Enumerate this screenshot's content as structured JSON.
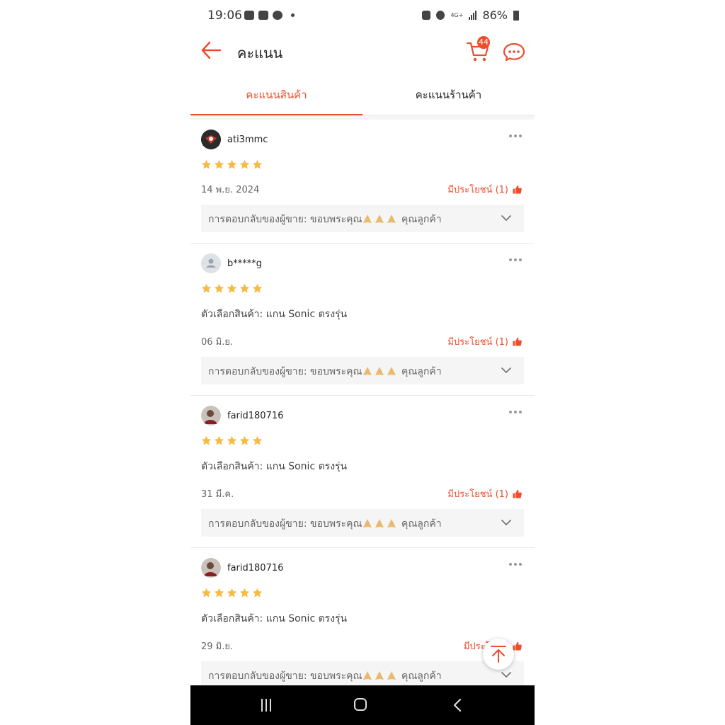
{
  "status_bar": {
    "time": "19:06",
    "network": "4G+",
    "battery": "86%"
  },
  "header": {
    "title": "คะแนน",
    "cart_count": "44",
    "icons": {
      "back": "arrow-left-icon",
      "cart": "cart-icon",
      "chat": "chat-icon"
    },
    "accent_color": "#ee4d2d"
  },
  "tabs": [
    {
      "label": "คะแนนสินค้า",
      "active": true
    },
    {
      "label": "คะแนนร้านค้า",
      "active": false
    }
  ],
  "reviews": [
    {
      "username": "ati3mmc",
      "rating": 5,
      "variation": "",
      "date": "14 พ.ย. 2024",
      "helpful": "มีประโยชน์ (1)",
      "reply_prefix": "การตอบกลับของผู้ขาย: ขอบพระคุณ",
      "reply_suffix": "คุณลูกค้า"
    },
    {
      "username": "b*****g",
      "rating": 5,
      "variation": "ตัวเลือกสินค้า: แกน Sonic ตรงรุ่น",
      "date": "06 มิ.ย.",
      "helpful": "มีประโยชน์ (1)",
      "reply_prefix": "การตอบกลับของผู้ขาย: ขอบพระคุณ",
      "reply_suffix": "คุณลูกค้า"
    },
    {
      "username": "farid180716",
      "rating": 5,
      "variation": "ตัวเลือกสินค้า: แกน Sonic ตรงรุ่น",
      "date": "31 มี.ค.",
      "helpful": "มีประโยชน์ (1)",
      "reply_prefix": "การตอบกลับของผู้ขาย: ขอบพระคุณ",
      "reply_suffix": "คุณลูกค้า"
    },
    {
      "username": "farid180716",
      "rating": 5,
      "variation": "ตัวเลือกสินค้า: แกน Sonic ตรงรุ่น",
      "date": "29 มิ.ย.",
      "helpful": "มีประโยชน์",
      "reply_prefix": "การตอบกลับของผู้ขาย: ขอบพระคุณ",
      "reply_suffix": "คุณลูกค้า"
    }
  ],
  "colors": {
    "star": "#f6bb42",
    "accent": "#ee4d2d",
    "reply_bg": "#f5f5f5"
  }
}
